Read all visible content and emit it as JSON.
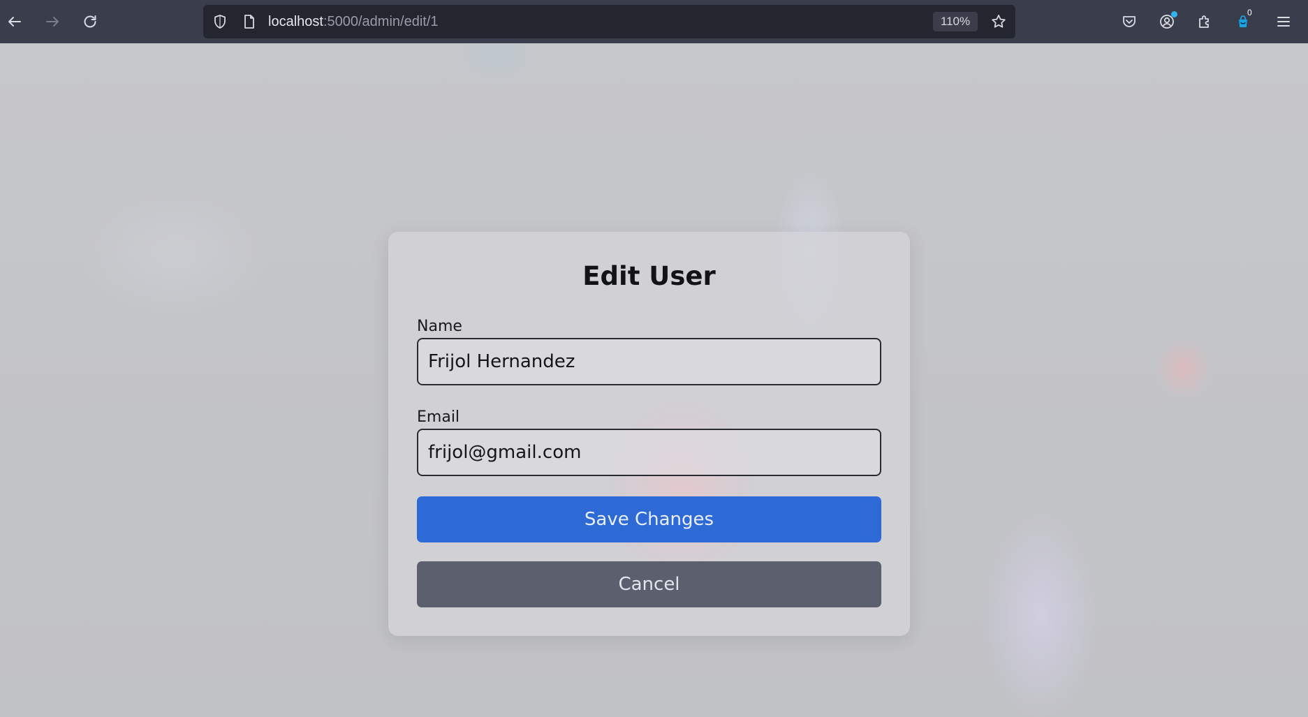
{
  "browser": {
    "url_host": "localhost",
    "url_path": ":5000/admin/edit/1",
    "zoom": "110%",
    "notification_count": "0",
    "icons": {
      "back": "arrow-left-icon",
      "forward": "arrow-right-icon",
      "reload": "reload-icon",
      "tracking": "shield-icon",
      "page": "page-icon",
      "bookmark": "star-icon",
      "pocket": "pocket-icon",
      "account": "account-icon",
      "extensions": "puzzle-icon",
      "extension": "extension-badge-icon",
      "menu": "hamburger-menu-icon"
    }
  },
  "form": {
    "title": "Edit User",
    "name_label": "Name",
    "name_value": "Frijol Hernandez",
    "email_label": "Email",
    "email_value": "frijol@gmail.com",
    "save_label": "Save Changes",
    "cancel_label": "Cancel"
  },
  "colors": {
    "primary_button": "#2e6ad6",
    "secondary_button": "#5b5f6e",
    "toolbar": "#3a3d4c",
    "urlbar": "#23252f"
  }
}
